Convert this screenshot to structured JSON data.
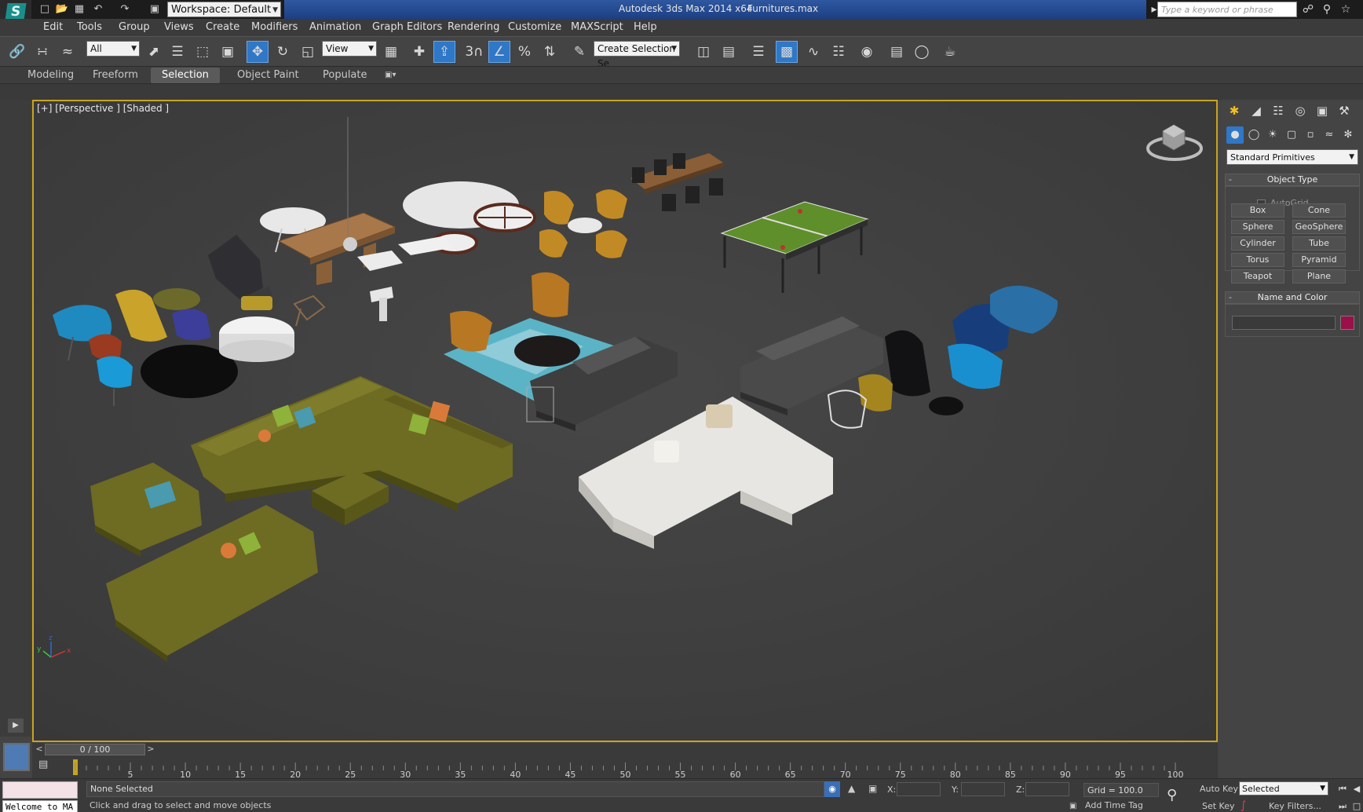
{
  "titlebar": {
    "workspace": "Workspace: Default",
    "app_title": "Autodesk 3ds Max  2014 x64",
    "file_name": "Furnitures.max",
    "search_placeholder": "Type a keyword or phrase",
    "bg_color": "#1c3f84"
  },
  "menus": [
    "Edit",
    "Tools",
    "Group",
    "Views",
    "Create",
    "Modifiers",
    "Animation",
    "Graph Editors",
    "Rendering",
    "Customize",
    "MAXScript",
    "Help"
  ],
  "toolbar": {
    "selection_filter": "All",
    "reference_coord": "View",
    "named_selection": "Create Selection Se"
  },
  "ribbon": {
    "tabs": [
      "Modeling",
      "Freeform",
      "Selection",
      "Object Paint",
      "Populate"
    ],
    "active_tab": "Selection"
  },
  "viewport": {
    "label": "[+] [Perspective ] [Shaded ]",
    "border_color": "#c8a41e",
    "axis_labels": {
      "x": "x",
      "y": "y",
      "z": "z"
    }
  },
  "command_panel": {
    "category": "Standard Primitives",
    "object_type_title": "Object Type",
    "autogrid_label": "AutoGrid",
    "primitives": [
      "Box",
      "Cone",
      "Sphere",
      "GeoSphere",
      "Cylinder",
      "Tube",
      "Torus",
      "Pyramid",
      "Teapot",
      "Plane"
    ],
    "name_color_title": "Name and Color",
    "object_color": "#9b1048"
  },
  "timeline": {
    "frame_display": "0 / 100",
    "ticks": [
      "5",
      "10",
      "15",
      "20",
      "25",
      "30",
      "35",
      "40",
      "45",
      "50",
      "55",
      "60",
      "65",
      "70",
      "75",
      "80",
      "85",
      "90",
      "95",
      "100"
    ]
  },
  "status": {
    "welcome": "Welcome to MA",
    "selection_text": "None Selected",
    "prompt": "Click and drag to select and move objects",
    "x_label": "X:",
    "y_label": "Y:",
    "z_label": "Z:",
    "grid": "Grid = 100.0",
    "add_time_tag": "Add Time Tag",
    "auto_key": "Auto Key",
    "set_key": "Set Key",
    "key_mode": "Selected",
    "key_filters": "Key Filters..."
  }
}
